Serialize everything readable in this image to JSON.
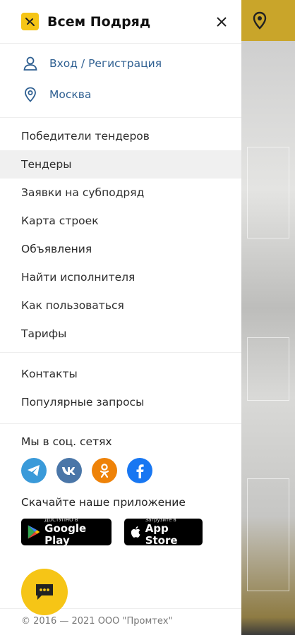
{
  "brand": {
    "name": "Всем Подряд"
  },
  "account": {
    "login": "Вход / Регистрация",
    "city": "Москва"
  },
  "menu": [
    {
      "label": "Победители тендеров"
    },
    {
      "label": "Тендеры",
      "active": true
    },
    {
      "label": "Заявки на субподряд"
    },
    {
      "label": "Карта строек"
    },
    {
      "label": "Объявления"
    },
    {
      "label": "Найти исполнителя"
    },
    {
      "label": "Как пользоваться"
    },
    {
      "label": "Тарифы"
    }
  ],
  "menu2": [
    {
      "label": "Контакты"
    },
    {
      "label": "Популярные запросы"
    }
  ],
  "social": {
    "title": "Мы в соц. сетях",
    "networks": [
      "telegram-icon",
      "vk-icon",
      "odnoklassniki-icon",
      "facebook-icon"
    ]
  },
  "apps": {
    "title": "Скачайте наше приложение",
    "google_small": "ДОСТУПНО В",
    "google_big": "Google Play",
    "apple_small": "Загрузите в",
    "apple_big": "App Store"
  },
  "footer": {
    "copyright": "© 2016 — 2021 ООО \"Промтех\""
  },
  "colors": {
    "accent": "#f6c516",
    "link": "#2e5f91",
    "telegram": "#3a9ad9",
    "vk": "#4a76a8",
    "ok": "#ee8208",
    "facebook": "#1877f2"
  }
}
